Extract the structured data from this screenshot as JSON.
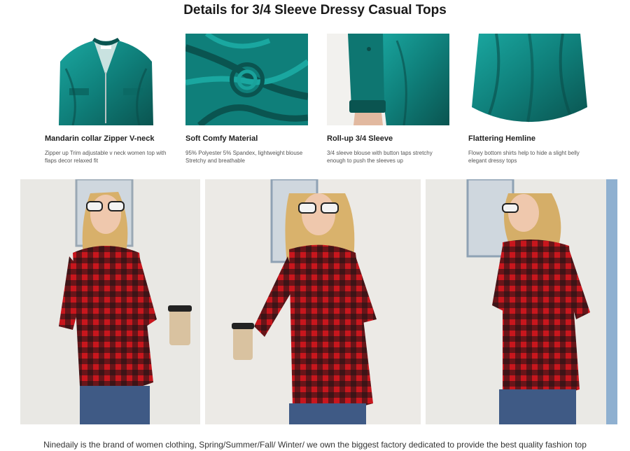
{
  "header": {
    "title": "Details for 3/4 Sleeve Dressy Casual Tops"
  },
  "details": [
    {
      "heading": "Mandarin collar Zipper V-neck",
      "description": "Zipper up Trim adjustable v neck women top with flaps decor relaxed fit",
      "icon": "collar-closeup-photo"
    },
    {
      "heading": "Soft Comfy Material",
      "description": "95% Polyester 5% Spandex, lightweight blouse Stretchy and breathable",
      "icon": "fabric-swirl-photo"
    },
    {
      "heading": "Roll-up 3/4 Sleeve",
      "description": "3/4 sleeve blouse with button taps stretchy enough to push the sleeves up",
      "icon": "sleeve-closeup-photo"
    },
    {
      "heading": "Flattering Hemline",
      "description": "Flowy bottom shirts help to hide a slight belly elegant dressy tops",
      "icon": "hemline-photo"
    }
  ],
  "photos": [
    {
      "name": "model-front-photo"
    },
    {
      "name": "model-side-photo"
    },
    {
      "name": "model-back-photo"
    }
  ],
  "colors": {
    "teal": "#0f7f7a",
    "teal_dark": "#0a5450",
    "plaid_red": "#c8161d",
    "plaid_black": "#1a1416",
    "denim": "#3f5a85"
  },
  "footer": {
    "text": "Ninedaily is the brand of women clothing, Spring/Summer/Fall/ Winter/ we own the biggest factory dedicated to provide the best quality fashion top"
  }
}
